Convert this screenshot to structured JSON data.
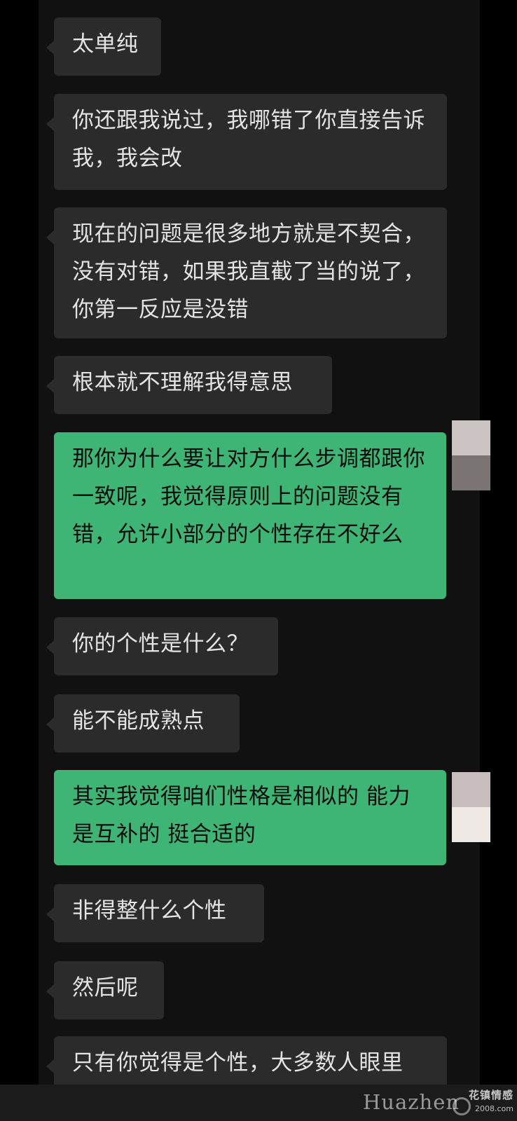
{
  "messages": [
    {
      "side": "in",
      "text": "太单纯"
    },
    {
      "side": "in",
      "text": "你还跟我说过，我哪错了你直接告诉我，我会改"
    },
    {
      "side": "in",
      "text": "现在的问题是很多地方就是不契合，没有对错，如果我直截了当的说了，你第一反应是没错"
    },
    {
      "side": "in",
      "text": "根本就不理解我得意思"
    },
    {
      "side": "out",
      "text": "那你为什么要让对方什么步调都跟你一致呢，我觉得原则上的问题没有错，允许小部分的个性存在不好么"
    },
    {
      "side": "in",
      "text": "你的个性是什么？"
    },
    {
      "side": "in",
      "text": "能不能成熟点"
    },
    {
      "side": "out",
      "text": "其实我觉得咱们性格是相似的 能力是互补的 挺合适的"
    },
    {
      "side": "in",
      "text": "非得整什么个性"
    },
    {
      "side": "in",
      "text": "然后呢"
    },
    {
      "side": "in",
      "text": "只有你觉得是个性，大多数人眼里"
    }
  ],
  "watermark": {
    "brand_latin": "Huazhen",
    "brand_cn": "花镇情感",
    "number": "2008.com"
  },
  "colors": {
    "incoming_bubble": "#2b2b2b",
    "outgoing_bubble": "#3eb574",
    "background": "#111111"
  }
}
